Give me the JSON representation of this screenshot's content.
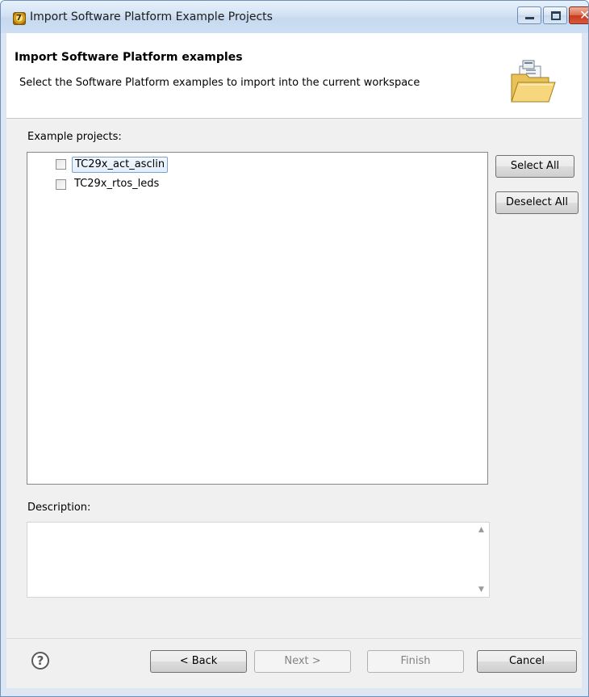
{
  "window": {
    "title": "Import Software Platform Example Projects",
    "app_icon_glyph": "7",
    "controls": {
      "minimize": "minimize-icon",
      "maximize": "maximize-icon",
      "close": "close-icon"
    }
  },
  "banner": {
    "title": "Import Software Platform examples",
    "message": "Select the Software Platform examples to import into the current workspace",
    "icon": "open-folder-icon"
  },
  "projects": {
    "label": "Example projects:",
    "items": [
      {
        "name": "TC29x_act_asclin",
        "checked": false,
        "focused": true
      },
      {
        "name": "TC29x_rtos_leds",
        "checked": false,
        "focused": false
      }
    ],
    "select_all": "Select All",
    "deselect_all": "Deselect All"
  },
  "description": {
    "label": "Description:",
    "value": ""
  },
  "footer": {
    "help_glyph": "?",
    "back": "< Back",
    "next": "Next >",
    "finish": "Finish",
    "cancel": "Cancel"
  },
  "colors": {
    "title_bar": "#cddff3",
    "close_button": "#c7391d",
    "dialog_bg": "#f0f0f0",
    "focus_border": "#7da2ce"
  }
}
